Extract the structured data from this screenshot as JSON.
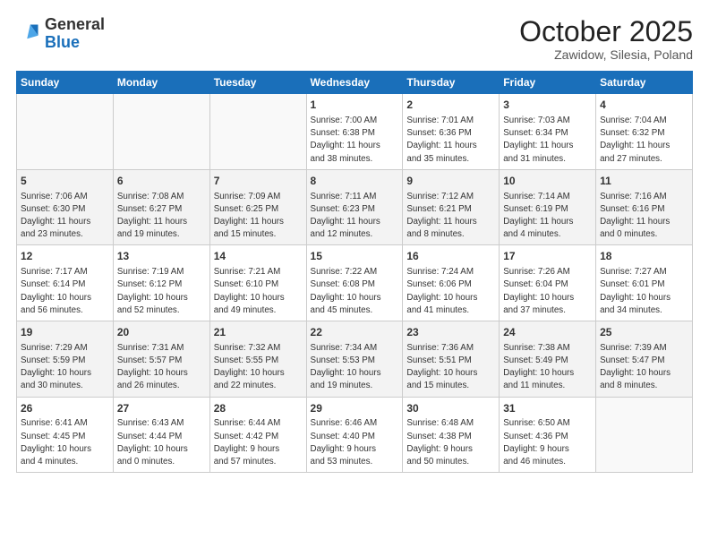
{
  "header": {
    "logo_general": "General",
    "logo_blue": "Blue",
    "month": "October 2025",
    "location": "Zawidow, Silesia, Poland"
  },
  "weekdays": [
    "Sunday",
    "Monday",
    "Tuesday",
    "Wednesday",
    "Thursday",
    "Friday",
    "Saturday"
  ],
  "weeks": [
    [
      {
        "day": "",
        "info": ""
      },
      {
        "day": "",
        "info": ""
      },
      {
        "day": "",
        "info": ""
      },
      {
        "day": "1",
        "info": "Sunrise: 7:00 AM\nSunset: 6:38 PM\nDaylight: 11 hours\nand 38 minutes."
      },
      {
        "day": "2",
        "info": "Sunrise: 7:01 AM\nSunset: 6:36 PM\nDaylight: 11 hours\nand 35 minutes."
      },
      {
        "day": "3",
        "info": "Sunrise: 7:03 AM\nSunset: 6:34 PM\nDaylight: 11 hours\nand 31 minutes."
      },
      {
        "day": "4",
        "info": "Sunrise: 7:04 AM\nSunset: 6:32 PM\nDaylight: 11 hours\nand 27 minutes."
      }
    ],
    [
      {
        "day": "5",
        "info": "Sunrise: 7:06 AM\nSunset: 6:30 PM\nDaylight: 11 hours\nand 23 minutes."
      },
      {
        "day": "6",
        "info": "Sunrise: 7:08 AM\nSunset: 6:27 PM\nDaylight: 11 hours\nand 19 minutes."
      },
      {
        "day": "7",
        "info": "Sunrise: 7:09 AM\nSunset: 6:25 PM\nDaylight: 11 hours\nand 15 minutes."
      },
      {
        "day": "8",
        "info": "Sunrise: 7:11 AM\nSunset: 6:23 PM\nDaylight: 11 hours\nand 12 minutes."
      },
      {
        "day": "9",
        "info": "Sunrise: 7:12 AM\nSunset: 6:21 PM\nDaylight: 11 hours\nand 8 minutes."
      },
      {
        "day": "10",
        "info": "Sunrise: 7:14 AM\nSunset: 6:19 PM\nDaylight: 11 hours\nand 4 minutes."
      },
      {
        "day": "11",
        "info": "Sunrise: 7:16 AM\nSunset: 6:16 PM\nDaylight: 11 hours\nand 0 minutes."
      }
    ],
    [
      {
        "day": "12",
        "info": "Sunrise: 7:17 AM\nSunset: 6:14 PM\nDaylight: 10 hours\nand 56 minutes."
      },
      {
        "day": "13",
        "info": "Sunrise: 7:19 AM\nSunset: 6:12 PM\nDaylight: 10 hours\nand 52 minutes."
      },
      {
        "day": "14",
        "info": "Sunrise: 7:21 AM\nSunset: 6:10 PM\nDaylight: 10 hours\nand 49 minutes."
      },
      {
        "day": "15",
        "info": "Sunrise: 7:22 AM\nSunset: 6:08 PM\nDaylight: 10 hours\nand 45 minutes."
      },
      {
        "day": "16",
        "info": "Sunrise: 7:24 AM\nSunset: 6:06 PM\nDaylight: 10 hours\nand 41 minutes."
      },
      {
        "day": "17",
        "info": "Sunrise: 7:26 AM\nSunset: 6:04 PM\nDaylight: 10 hours\nand 37 minutes."
      },
      {
        "day": "18",
        "info": "Sunrise: 7:27 AM\nSunset: 6:01 PM\nDaylight: 10 hours\nand 34 minutes."
      }
    ],
    [
      {
        "day": "19",
        "info": "Sunrise: 7:29 AM\nSunset: 5:59 PM\nDaylight: 10 hours\nand 30 minutes."
      },
      {
        "day": "20",
        "info": "Sunrise: 7:31 AM\nSunset: 5:57 PM\nDaylight: 10 hours\nand 26 minutes."
      },
      {
        "day": "21",
        "info": "Sunrise: 7:32 AM\nSunset: 5:55 PM\nDaylight: 10 hours\nand 22 minutes."
      },
      {
        "day": "22",
        "info": "Sunrise: 7:34 AM\nSunset: 5:53 PM\nDaylight: 10 hours\nand 19 minutes."
      },
      {
        "day": "23",
        "info": "Sunrise: 7:36 AM\nSunset: 5:51 PM\nDaylight: 10 hours\nand 15 minutes."
      },
      {
        "day": "24",
        "info": "Sunrise: 7:38 AM\nSunset: 5:49 PM\nDaylight: 10 hours\nand 11 minutes."
      },
      {
        "day": "25",
        "info": "Sunrise: 7:39 AM\nSunset: 5:47 PM\nDaylight: 10 hours\nand 8 minutes."
      }
    ],
    [
      {
        "day": "26",
        "info": "Sunrise: 6:41 AM\nSunset: 4:45 PM\nDaylight: 10 hours\nand 4 minutes."
      },
      {
        "day": "27",
        "info": "Sunrise: 6:43 AM\nSunset: 4:44 PM\nDaylight: 10 hours\nand 0 minutes."
      },
      {
        "day": "28",
        "info": "Sunrise: 6:44 AM\nSunset: 4:42 PM\nDaylight: 9 hours\nand 57 minutes."
      },
      {
        "day": "29",
        "info": "Sunrise: 6:46 AM\nSunset: 4:40 PM\nDaylight: 9 hours\nand 53 minutes."
      },
      {
        "day": "30",
        "info": "Sunrise: 6:48 AM\nSunset: 4:38 PM\nDaylight: 9 hours\nand 50 minutes."
      },
      {
        "day": "31",
        "info": "Sunrise: 6:50 AM\nSunset: 4:36 PM\nDaylight: 9 hours\nand 46 minutes."
      },
      {
        "day": "",
        "info": ""
      }
    ]
  ]
}
